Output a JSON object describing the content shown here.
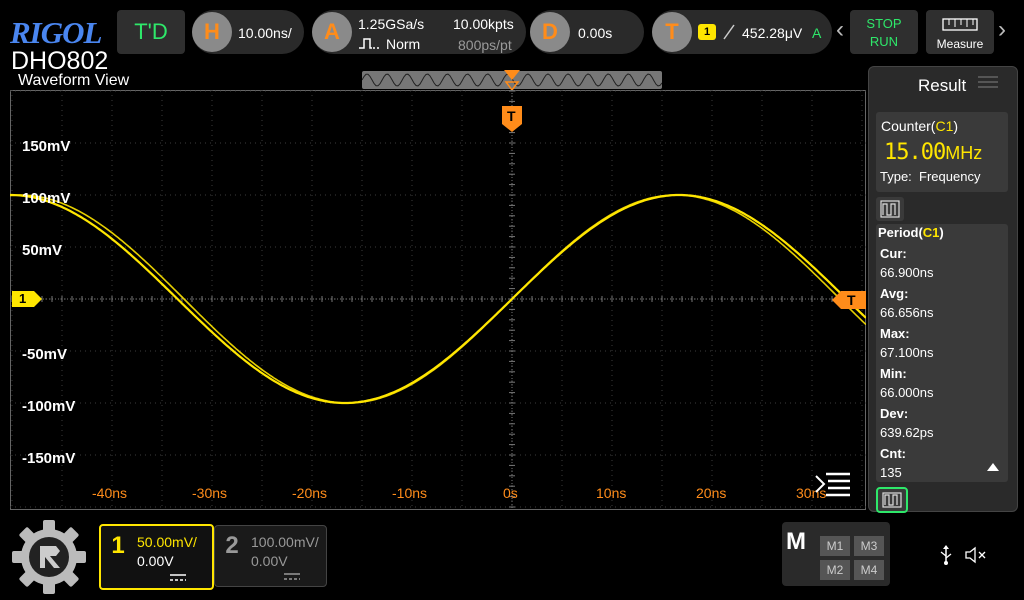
{
  "brand": {
    "logo": "RIGOL",
    "model": "DHO802"
  },
  "topbar": {
    "td_label": "T'D",
    "horizontal": {
      "letter": "H",
      "scale": "10.00ns/"
    },
    "acquire": {
      "letter": "A",
      "sample_rate": "1.25GSa/s",
      "mode": "Norm",
      "memory": "10.00kpts",
      "resolution": "800ps/pt"
    },
    "delay": {
      "letter": "D",
      "value": "0.00s"
    },
    "trigger": {
      "letter": "T",
      "source": "1",
      "level": "452.28μV",
      "status": "A"
    },
    "stop_label": "STOP",
    "run_label": "RUN",
    "measure_label": "Measure"
  },
  "waveform_view": {
    "title": "Waveform View",
    "y_labels": [
      "150mV",
      "100mV",
      "50mV",
      "-50mV",
      "-100mV",
      "-150mV"
    ],
    "x_labels": [
      "-40ns",
      "-30ns",
      "-20ns",
      "-10ns",
      "0s",
      "10ns",
      "20ns",
      "30ns"
    ],
    "ch1_marker": "1",
    "trigger_marker": "T",
    "trace_color": "#ffe600"
  },
  "result_panel": {
    "title": "Result",
    "counter": {
      "label": "Counter(",
      "channel": "C1",
      "close": ")",
      "value": "15.00",
      "unit": "MHz",
      "type_label": "Type:",
      "type_value": "Frequency"
    },
    "period": {
      "label": "Period(",
      "channel": "C1",
      "close": ")",
      "rows": [
        {
          "key": "Cur:",
          "value": "66.900ns"
        },
        {
          "key": "Avg:",
          "value": "66.656ns"
        },
        {
          "key": "Max:",
          "value": "67.100ns"
        },
        {
          "key": "Min:",
          "value": "66.000ns"
        },
        {
          "key": "Dev:",
          "value": "639.62ps"
        },
        {
          "key": "Cnt:",
          "value": "135"
        }
      ]
    }
  },
  "bottombar": {
    "ch1": {
      "num": "1",
      "scale": "50.00mV/",
      "offset": "0.00V",
      "color": "#ffe600"
    },
    "ch2": {
      "num": "2",
      "scale": "100.00mV/",
      "offset": "0.00V"
    },
    "math": {
      "label": "M",
      "buttons": [
        "M1",
        "M3",
        "M2",
        "M4"
      ]
    }
  }
}
